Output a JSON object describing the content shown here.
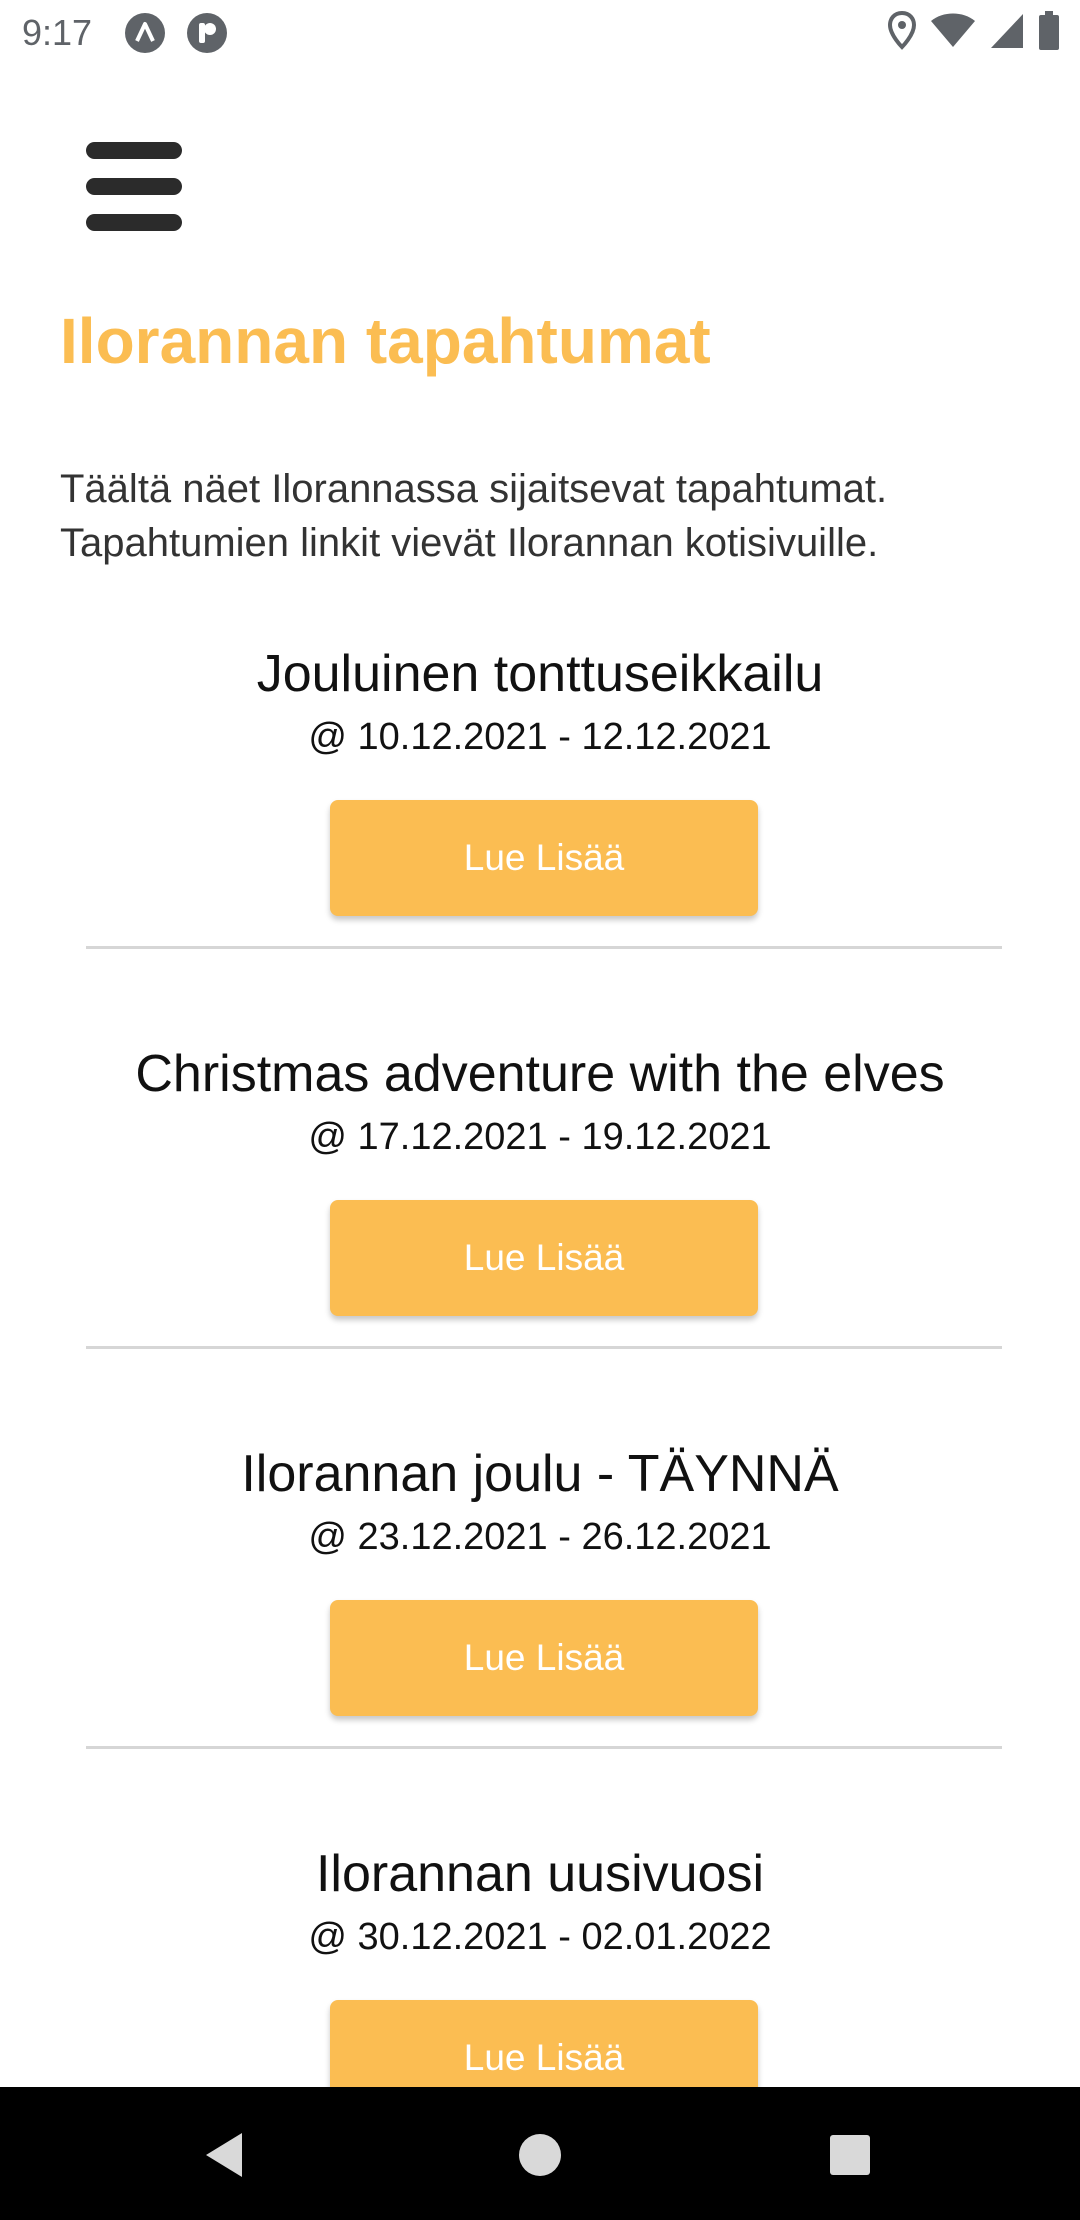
{
  "status_bar": {
    "time": "9:17",
    "left_icons": [
      "app-notification-icon",
      "app-notification-icon-2"
    ],
    "right_icons": [
      "location-icon",
      "wifi-icon",
      "cellular-signal-icon",
      "battery-icon"
    ]
  },
  "header": {
    "menu_icon": "hamburger-menu-icon"
  },
  "page": {
    "title": "Ilorannan tapahtumat",
    "intro_line1": "Täältä näet Ilorannassa sijaitsevat tapahtumat.",
    "intro_line2": "Tapahtumien linkit vievät Ilorannan kotisivuille."
  },
  "events": [
    {
      "title": "Jouluinen tonttuseikkailu",
      "date": "@ 10.12.2021 - 12.12.2021",
      "button": "Lue Lisää"
    },
    {
      "title": "Christmas adventure with the elves",
      "date": "@ 17.12.2021 - 19.12.2021",
      "button": "Lue Lisää"
    },
    {
      "title": "Ilorannan joulu - TÄYNNÄ",
      "date": "@ 23.12.2021 - 26.12.2021",
      "button": "Lue Lisää"
    },
    {
      "title": "Ilorannan uusivuosi",
      "date": "@ 30.12.2021 - 02.01.2022",
      "button": "Lue Lisää"
    }
  ],
  "nav_bar": {
    "buttons": [
      "back-icon",
      "home-icon",
      "recents-icon"
    ]
  },
  "colors": {
    "accent": "#fbbd52",
    "text": "#111111",
    "divider": "#d6d6d6"
  }
}
